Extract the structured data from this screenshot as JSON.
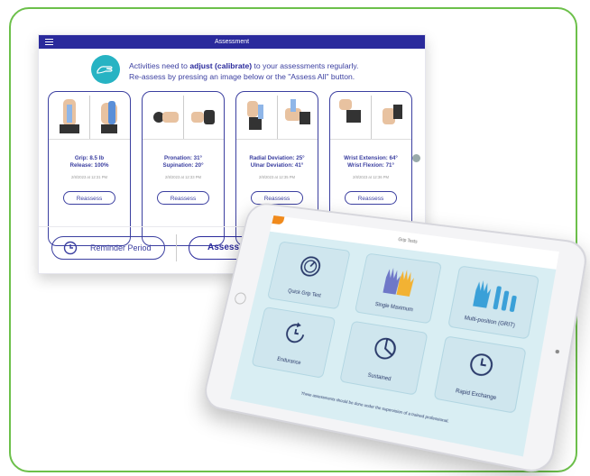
{
  "assessment": {
    "title": "Assessment",
    "banner_line1_pre": "Activities need to ",
    "banner_bold": "adjust (calibrate)",
    "banner_line1_post": " to your assessments regularly.",
    "banner_line2": "Re-assess by pressing an image below or the \"Assess All\" button.",
    "cards": [
      {
        "line1": "Grip: 8.5 lb",
        "line2": "Release: 100%",
        "date": "2/8/2023 at 12:31 PM",
        "button": "Reassess"
      },
      {
        "line1": "Pronation: 31°",
        "line2": "Supination: 20°",
        "date": "2/8/2023 at 12:33 PM",
        "button": "Reassess"
      },
      {
        "line1": "Radial Deviation: 25°",
        "line2": "Ulnar Deviation: 41°",
        "date": "2/8/2023 at 12:35 PM",
        "button": "Reassess"
      },
      {
        "line1": "Wrist Extension: 64°",
        "line2": "Wrist Flexion: 71°",
        "date": "2/8/2023 at 12:36 PM",
        "button": "Reassess"
      }
    ],
    "reminder_label": "Reminder Period",
    "assess_all_label": "Assess All"
  },
  "grip_tests": {
    "title": "Grip Tests",
    "tiles": [
      {
        "label": "Quick Grip Test",
        "icon": "gauge-icon"
      },
      {
        "label": "Single Maximum",
        "icon": "gloves-icon"
      },
      {
        "label": "Multi-position (GRIT)",
        "icon": "glove-bars-icon"
      },
      {
        "label": "Endurance",
        "icon": "clock-arrow-icon"
      },
      {
        "label": "Sustained",
        "icon": "pie-clock-icon"
      },
      {
        "label": "Rapid Exchange",
        "icon": "clock-icon"
      }
    ],
    "footnote": "These assessments should be done under the supervision of a trained professional."
  },
  "colors": {
    "accent": "#2a2a9c",
    "border": "#6cc04a",
    "teal": "#27b3c3",
    "tile": "#cfe6ee"
  }
}
